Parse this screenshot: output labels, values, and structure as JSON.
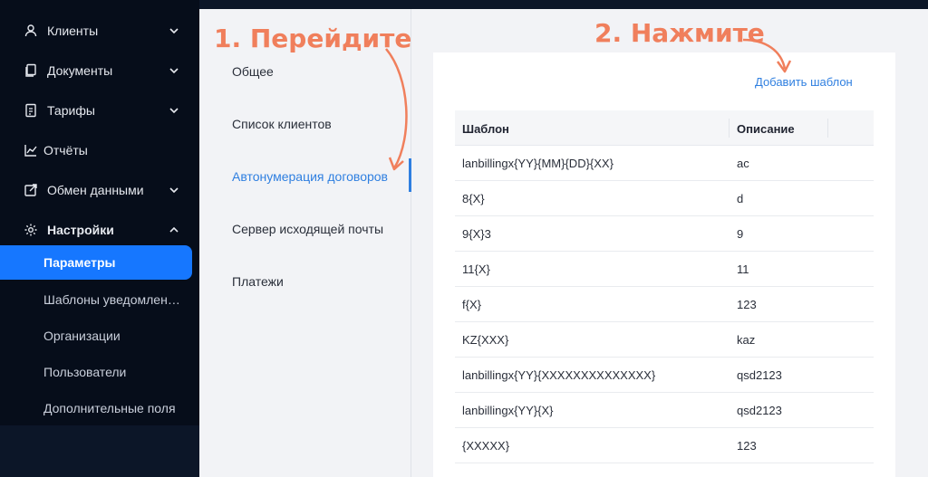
{
  "colors": {
    "accent": "#1677ff",
    "link": "#2f7fe0",
    "annotation": "#f07f5c",
    "sidebar_bg": "#060d1a"
  },
  "sidebar": {
    "items": [
      {
        "label": "Клиенты",
        "icon": "user-icon",
        "expandable": true
      },
      {
        "label": "Документы",
        "icon": "documents-icon",
        "expandable": true
      },
      {
        "label": "Тарифы",
        "icon": "tariff-icon",
        "expandable": true
      },
      {
        "label": "Отчёты",
        "icon": "chart-icon",
        "expandable": false
      },
      {
        "label": "Обмен данными",
        "icon": "exchange-icon",
        "expandable": true
      },
      {
        "label": "Настройки",
        "icon": "gear-icon",
        "expandable": true,
        "expanded": true
      }
    ],
    "subitems": [
      {
        "label": "Параметры",
        "active": true
      },
      {
        "label": "Шаблоны уведомлений"
      },
      {
        "label": "Организации"
      },
      {
        "label": "Пользователи"
      },
      {
        "label": "Дополнительные поля"
      }
    ]
  },
  "settings_menu": {
    "items": [
      {
        "label": "Общее"
      },
      {
        "label": "Список клиентов"
      },
      {
        "label": "Автонумерация договоров",
        "active": true
      },
      {
        "label": "Сервер исходящей почты"
      },
      {
        "label": "Платежи"
      }
    ]
  },
  "content": {
    "add_template_label": "Добавить шаблон",
    "table": {
      "columns": [
        "Шаблон",
        "Описание"
      ],
      "rows": [
        [
          "lanbillingx{YY}{MM}{DD}{XX}",
          "ac"
        ],
        [
          "8{X}",
          "d"
        ],
        [
          "9{X}3",
          "9"
        ],
        [
          "11{X}",
          "11"
        ],
        [
          "f{X}",
          "123"
        ],
        [
          "KZ{XXX}",
          "kaz"
        ],
        [
          "lanbillingx{YY}{XXXXXXXXXXXXXX}",
          "qsd2123"
        ],
        [
          "lanbillingx{YY}{X}",
          "qsd2123"
        ],
        [
          "{XXXXX}",
          "123"
        ]
      ]
    }
  },
  "annotations": {
    "step1": "1. Перейдите",
    "step2": "2. Нажмите"
  }
}
